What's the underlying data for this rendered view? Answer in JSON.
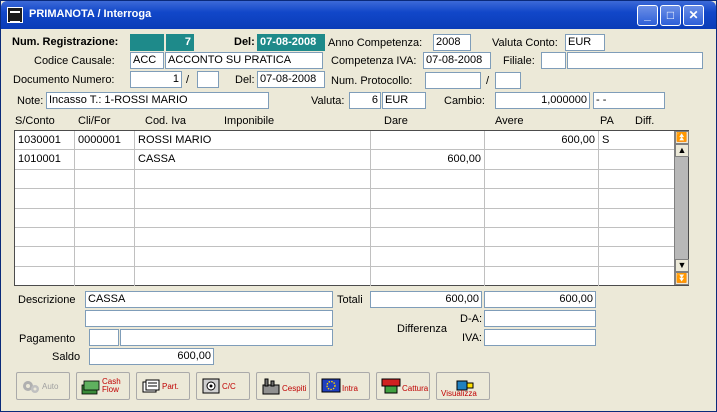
{
  "window": {
    "title": "PRIMANOTA / Interroga"
  },
  "header": {
    "num_registrazione_label": "Num. Registrazione:",
    "num_registrazione_value": "7",
    "del_label": "Del:",
    "del_value": "07-08-2008",
    "anno_competenza_label": "Anno Competenza:",
    "anno_competenza_value": "2008",
    "valuta_conto_label": "Valuta Conto:",
    "valuta_conto_value": "EUR",
    "codice_causale_label": "Codice Causale:",
    "codice_causale_code": "ACC",
    "codice_causale_desc": "ACCONTO SU PRATICA",
    "competenza_iva_label": "Competenza IVA:",
    "competenza_iva_value": "07-08-2008",
    "filiale_label": "Filiale:",
    "documento_numero_label": "Documento Numero:",
    "documento_numero_value": "1",
    "slash": "/",
    "doc_del_label": "Del:",
    "doc_del_value": "07-08-2008",
    "num_protocollo_label": "Num. Protocollo:",
    "note_label": "Note:",
    "note_value": "Incasso T.:    1-ROSSI MARIO",
    "valuta_label": "Valuta:",
    "valuta_code": "6",
    "valuta_value": "EUR",
    "cambio_label": "Cambio:",
    "cambio_value": "1,000000",
    "cambio_extra": "- -"
  },
  "grid": {
    "columns": [
      "S/Conto",
      "Cli/For",
      "Cod. Iva",
      "Imponibile",
      "Dare",
      "Avere",
      "PA",
      "Diff."
    ],
    "rows": [
      {
        "sconto": "1030001",
        "clifor": "0000001",
        "desc": "ROSSI MARIO",
        "dare": "",
        "avere": "600,00",
        "pa": "S"
      },
      {
        "sconto": "1010001",
        "clifor": "",
        "desc": "CASSA",
        "dare": "600,00",
        "avere": "",
        "pa": ""
      }
    ]
  },
  "footer": {
    "descrizione_label": "Descrizione",
    "descrizione_value": "CASSA",
    "totali_label": "Totali",
    "totali_dare": "600,00",
    "totali_avere": "600,00",
    "differenza_label": "Differenza",
    "da_label": "D-A:",
    "iva_label": "IVA:",
    "pagamento_label": "Pagamento",
    "saldo_label": "Saldo",
    "saldo_value": "600,00"
  },
  "toolbar": {
    "auto": "Auto",
    "cash_flow_1": "Cash",
    "cash_flow_2": "Flow",
    "part": "Part.",
    "cc": "C/C",
    "cespiti": "Cespiti",
    "intra": "Intra",
    "cattura": "Cattura",
    "visualizza": "Visualizza"
  },
  "colors": {
    "accent_teal": "#1e8a8a",
    "title_blue": "#0a3cb8",
    "button_text_red": "#c00000"
  }
}
